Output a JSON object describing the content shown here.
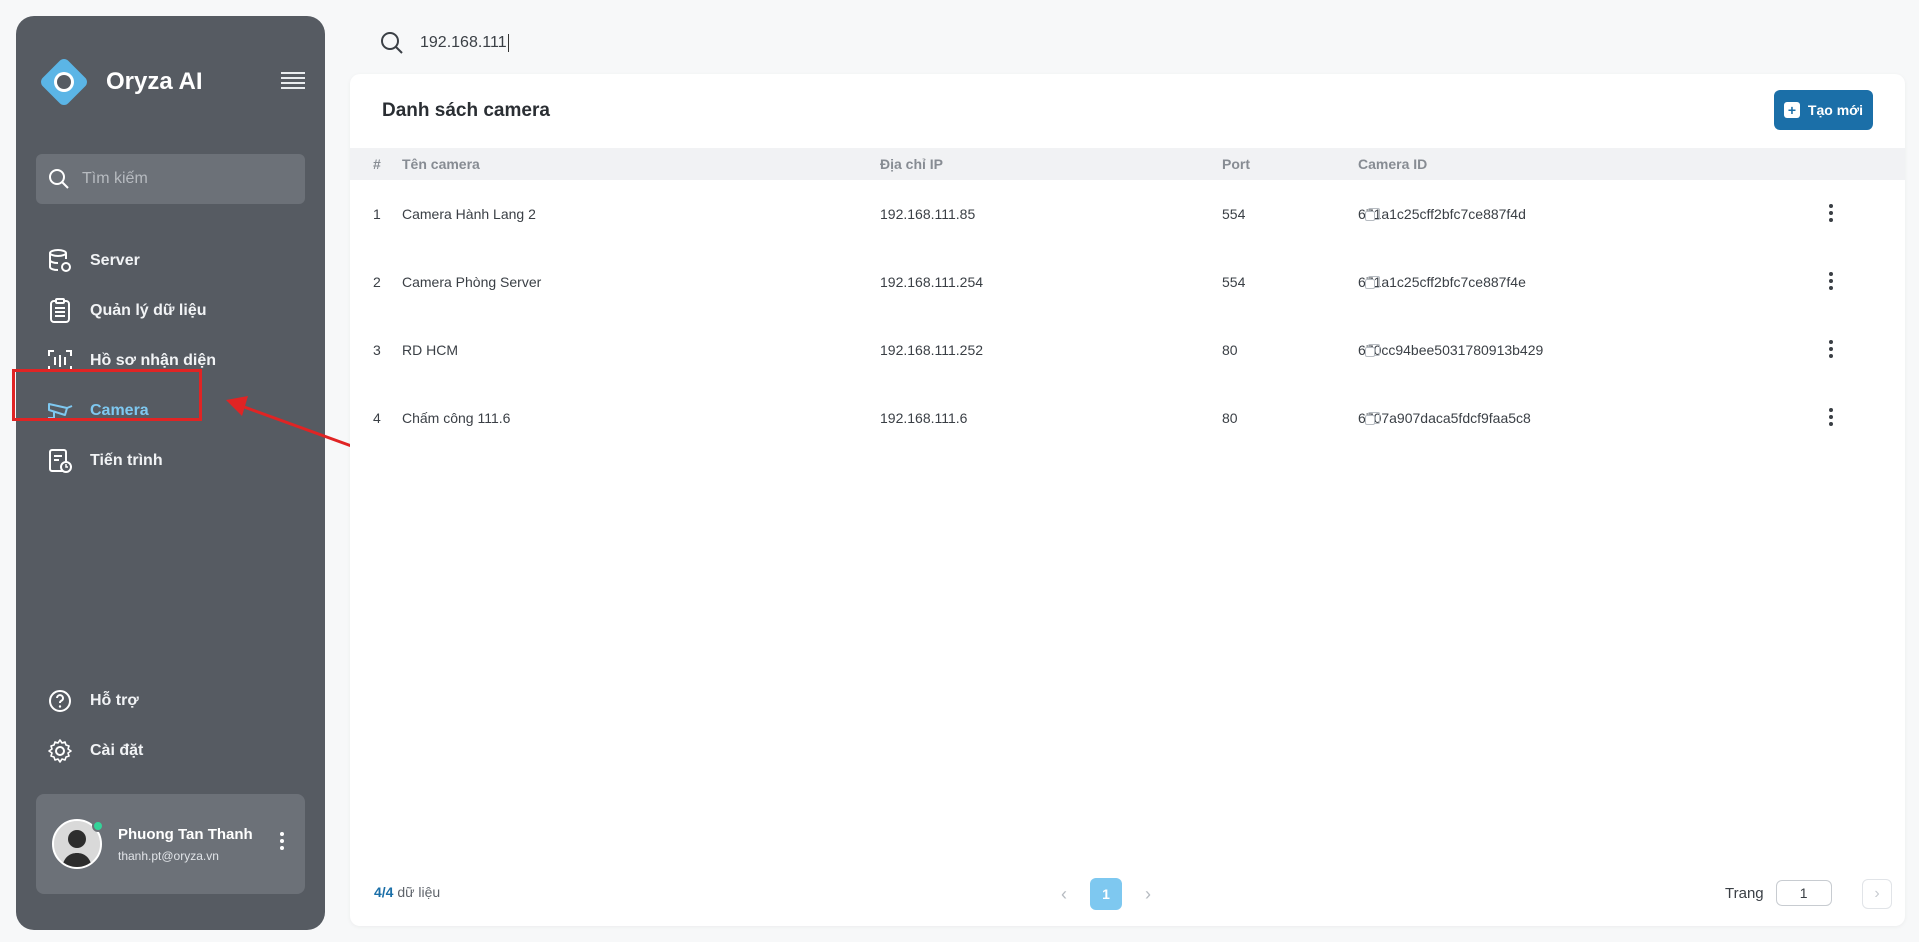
{
  "app": {
    "brand": "Oryza AI",
    "accent": "#7ec8f0",
    "primary": "#1b6fa8",
    "annotation_color": "#e02424"
  },
  "sidebar": {
    "search_placeholder": "Tìm kiếm",
    "items": [
      {
        "label": "Server",
        "icon": "server-icon"
      },
      {
        "label": "Quản lý dữ liệu",
        "icon": "clipboard-list-icon"
      },
      {
        "label": "Hồ sơ nhận diện",
        "icon": "face-scan-icon"
      },
      {
        "label": "Camera",
        "icon": "camera-icon",
        "active": true
      },
      {
        "label": "Tiến trình",
        "icon": "process-icon"
      }
    ],
    "bottom_items": [
      {
        "label": "Hỗ trợ",
        "icon": "help-icon"
      },
      {
        "label": "Cài đặt",
        "icon": "gear-icon"
      }
    ],
    "user": {
      "name": "Phuong Tan Thanh",
      "email": "thanh.pt@oryza.vn",
      "online": true
    }
  },
  "search": {
    "value": "192.168.111"
  },
  "main": {
    "title": "Danh sách camera",
    "create_label": "Tạo mới",
    "columns": {
      "idx": "#",
      "name": "Tên camera",
      "ip": "Địa chỉ IP",
      "port": "Port",
      "id": "Camera ID"
    },
    "rows": [
      {
        "idx": "1",
        "name": "Camera Hành Lang 2",
        "ip": "192.168.111.85",
        "port": "554",
        "id": "671a1c25cff2bfc7ce887f4d"
      },
      {
        "idx": "2",
        "name": "Camera Phòng Server",
        "ip": "192.168.111.254",
        "port": "554",
        "id": "671a1c25cff2bfc7ce887f4e"
      },
      {
        "idx": "3",
        "name": "RD HCM",
        "ip": "192.168.111.252",
        "port": "80",
        "id": "670cc94bee5031780913b429"
      },
      {
        "idx": "4",
        "name": "Chấm công 111.6",
        "ip": "192.168.111.6",
        "port": "80",
        "id": "6707a907daca5fdcf9faa5c8"
      }
    ]
  },
  "footer": {
    "count_shown": "4",
    "count_sep": "/4",
    "count_suffix": " dữ liệu",
    "current_page": "1",
    "page_label": "Trang",
    "page_input": "1"
  }
}
